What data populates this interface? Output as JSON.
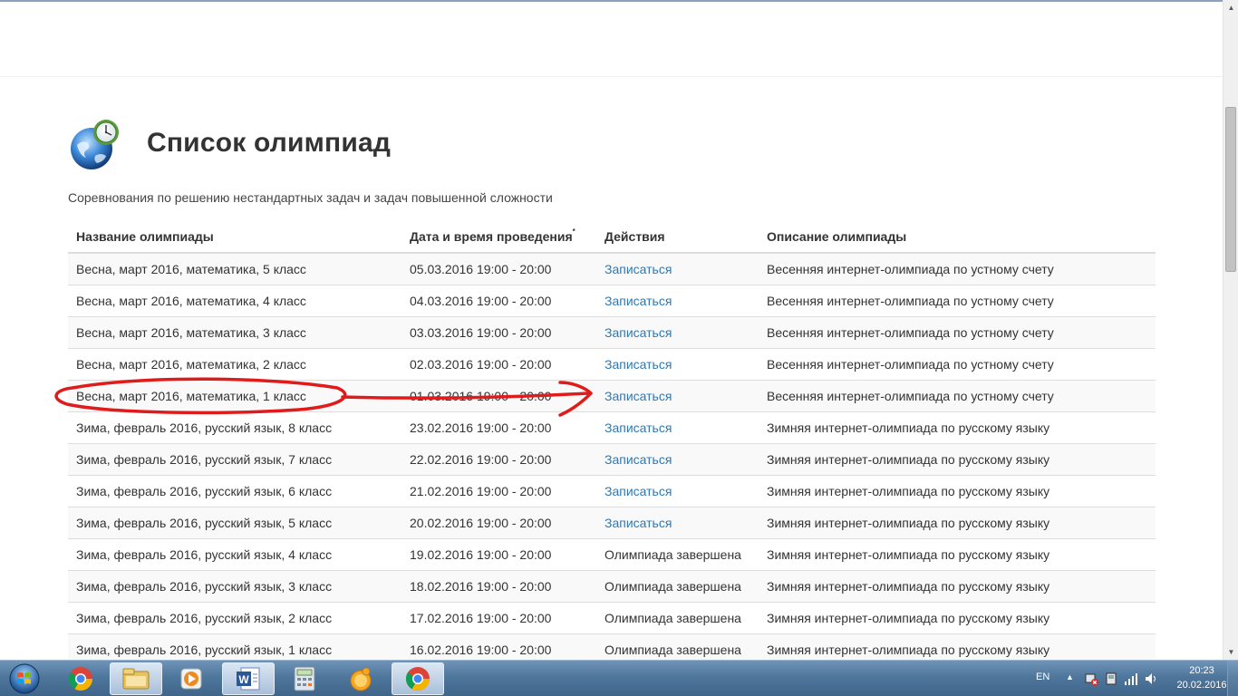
{
  "page": {
    "title": "Список олимпиад",
    "subtitle": "Соревнования по решению нестандартных задач и задач повышенной сложности"
  },
  "table": {
    "headers": {
      "name": "Название олимпиады",
      "date": "Дата и время проведения",
      "date_mark": "*",
      "actions": "Действия",
      "description": "Описание олимпиады"
    },
    "rows": [
      {
        "name": "Весна, март 2016, математика, 5 класс",
        "date": "05.03.2016 19:00 - 20:00",
        "action": "Записаться",
        "action_is_link": true,
        "description": "Весенняя интернет-олимпиада по устному счету"
      },
      {
        "name": "Весна, март 2016, математика, 4 класс",
        "date": "04.03.2016 19:00 - 20:00",
        "action": "Записаться",
        "action_is_link": true,
        "description": "Весенняя интернет-олимпиада по устному счету"
      },
      {
        "name": "Весна, март 2016, математика, 3 класс",
        "date": "03.03.2016 19:00 - 20:00",
        "action": "Записаться",
        "action_is_link": true,
        "description": "Весенняя интернет-олимпиада по устному счету"
      },
      {
        "name": "Весна, март 2016, математика, 2 класс",
        "date": "02.03.2016 19:00 - 20:00",
        "action": "Записаться",
        "action_is_link": true,
        "description": "Весенняя интернет-олимпиада по устному счету"
      },
      {
        "name": "Весна, март 2016, математика, 1 класс",
        "date": "01.03.2016 19:00 - 20:00",
        "action": "Записаться",
        "action_is_link": true,
        "description": "Весенняя интернет-олимпиада по устному счету"
      },
      {
        "name": "Зима, февраль 2016, русский язык, 8 класс",
        "date": "23.02.2016 19:00 - 20:00",
        "action": "Записаться",
        "action_is_link": true,
        "description": "Зимняя интернет-олимпиада по русскому языку"
      },
      {
        "name": "Зима, февраль 2016, русский язык, 7 класс",
        "date": "22.02.2016 19:00 - 20:00",
        "action": "Записаться",
        "action_is_link": true,
        "description": "Зимняя интернет-олимпиада по русскому языку"
      },
      {
        "name": "Зима, февраль 2016, русский язык, 6 класс",
        "date": "21.02.2016 19:00 - 20:00",
        "action": "Записаться",
        "action_is_link": true,
        "description": "Зимняя интернет-олимпиада по русскому языку"
      },
      {
        "name": "Зима, февраль 2016, русский язык, 5 класс",
        "date": "20.02.2016 19:00 - 20:00",
        "action": "Записаться",
        "action_is_link": true,
        "description": "Зимняя интернет-олимпиада по русскому языку"
      },
      {
        "name": "Зима, февраль 2016, русский язык, 4 класс",
        "date": "19.02.2016 19:00 - 20:00",
        "action": "Олимпиада завершена",
        "action_is_link": false,
        "description": "Зимняя интернет-олимпиада по русскому языку"
      },
      {
        "name": "Зима, февраль 2016, русский язык, 3 класс",
        "date": "18.02.2016 19:00 - 20:00",
        "action": "Олимпиада завершена",
        "action_is_link": false,
        "description": "Зимняя интернет-олимпиада по русскому языку"
      },
      {
        "name": "Зима, февраль 2016, русский язык, 2 класс",
        "date": "17.02.2016 19:00 - 20:00",
        "action": "Олимпиада завершена",
        "action_is_link": false,
        "description": "Зимняя интернет-олимпиада по русскому языку"
      },
      {
        "name": "Зима, февраль 2016, русский язык, 1 класс",
        "date": "16.02.2016 19:00 - 20:00",
        "action": "Олимпиада завершена",
        "action_is_link": false,
        "description": "Зимняя интернет-олимпиада по русскому языку"
      }
    ]
  },
  "annotation": {
    "color": "#e01b1b",
    "highlighted_row_index": 4
  },
  "colors": {
    "link": "#2a7ab8",
    "taskbar": "#4f769c"
  },
  "taskbar": {
    "items": [
      {
        "icon": "start-orb-icon",
        "active": false
      },
      {
        "icon": "chrome-icon",
        "active": false
      },
      {
        "icon": "file-explorer-icon",
        "active": true
      },
      {
        "icon": "media-player-icon",
        "active": false
      },
      {
        "icon": "word-icon",
        "active": true
      },
      {
        "icon": "calculator-icon",
        "active": false
      },
      {
        "icon": "messenger-icon",
        "active": false
      },
      {
        "icon": "chrome-icon",
        "active": true
      }
    ],
    "tray": {
      "language": "EN",
      "time": "20:23",
      "date": "20.02.2016"
    }
  }
}
